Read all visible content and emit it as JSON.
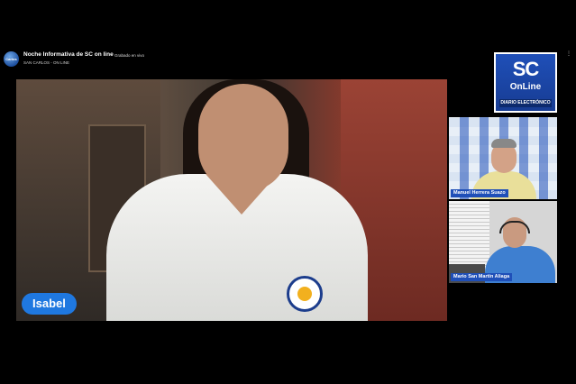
{
  "header": {
    "channel_logo_text": "Carlos",
    "title": "Noche Informativa de SC on line",
    "status": "Grabado en vivo",
    "subtitle": "SAN CARLOS - ON LINE",
    "more_icon": "more-vertical-icon"
  },
  "brand": {
    "line1": "SC",
    "line2": "OnLine",
    "tagline": "DIARIO ELECTRÓNICO",
    "color": "#1f4fb8"
  },
  "main_speaker": {
    "name": "Isabel",
    "label_color": "#1f78e0"
  },
  "participants": [
    {
      "name": "Manuel Herrera Suazo"
    },
    {
      "name": "Mario San Martín Aliaga"
    }
  ]
}
